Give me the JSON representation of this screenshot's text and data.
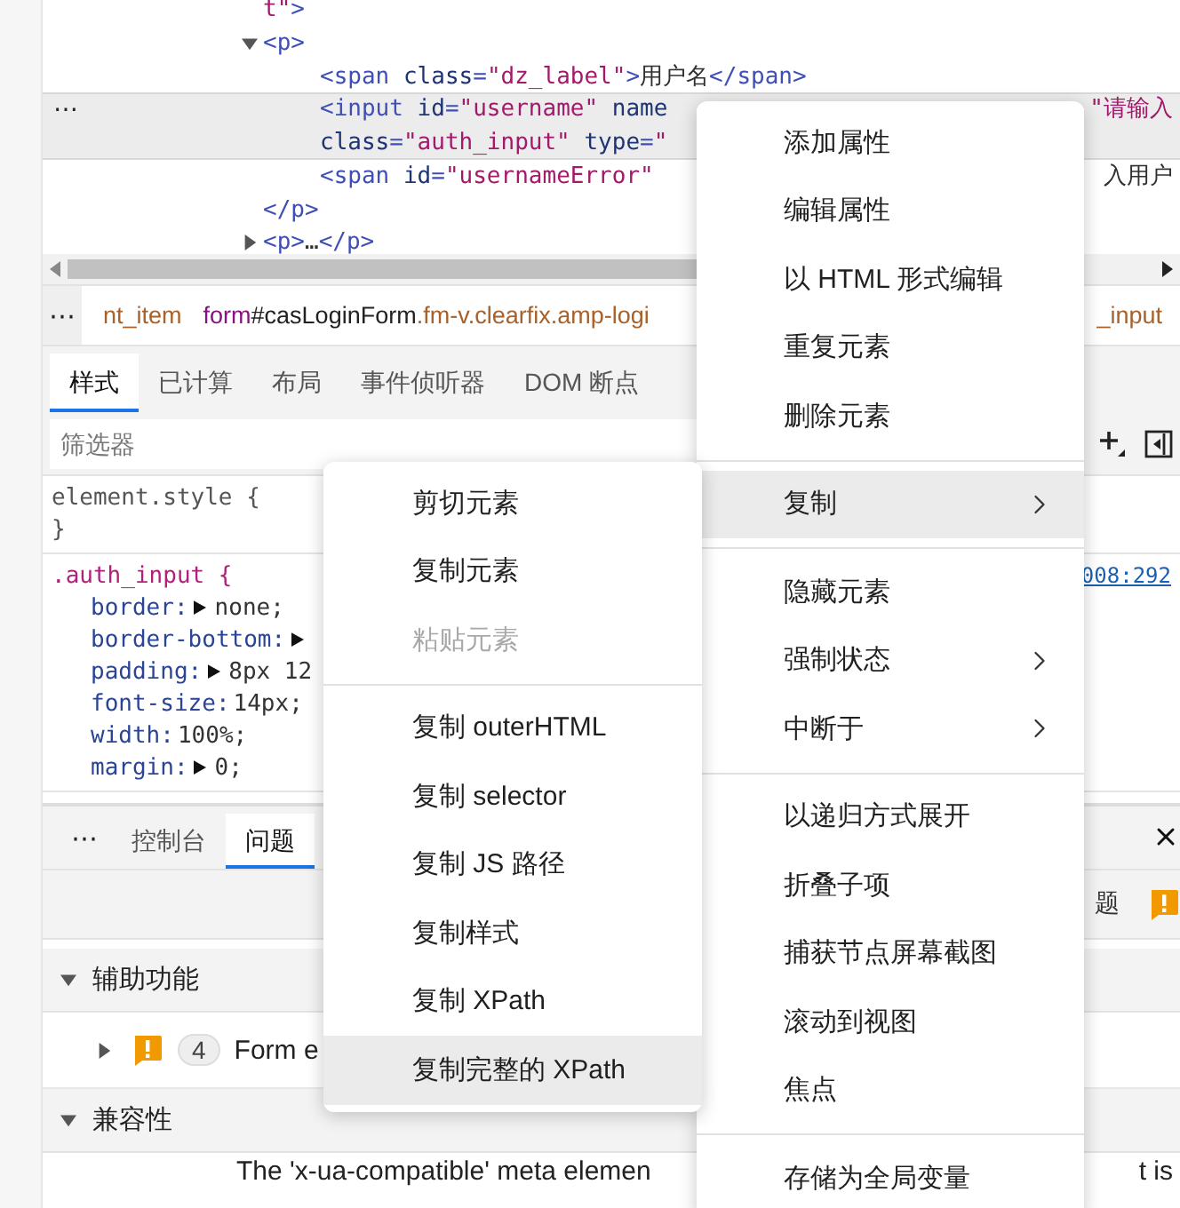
{
  "dom_tree": [
    {
      "tokens": [
        {
          "kind": "val",
          "t": "t\""
        },
        {
          "kind": "tag",
          "t": ">"
        }
      ],
      "selected": false
    },
    {
      "tokens": [
        {
          "kind": "tag",
          "t": "<p>"
        }
      ],
      "expanded": true,
      "selected": false,
      "children": [
        {
          "tokens": [
            {
              "kind": "tag",
              "t": "<span"
            },
            {
              "kind": "attr",
              "t": " class"
            },
            {
              "kind": "tag",
              "t": "="
            },
            {
              "kind": "val",
              "t": "\"dz_label\""
            },
            {
              "kind": "tag",
              "t": ">"
            },
            {
              "kind": "text",
              "t": "用户名"
            },
            {
              "kind": "tag",
              "t": "</span>"
            }
          ],
          "selected": false
        },
        {
          "tokens": [
            {
              "kind": "tag",
              "t": "<input"
            },
            {
              "kind": "attr",
              "t": " id"
            },
            {
              "kind": "tag",
              "t": "="
            },
            {
              "kind": "val",
              "t": "\"username\""
            },
            {
              "kind": "attr",
              "t": " name"
            }
          ],
          "more": [
            {
              "kind": "attr",
              "t": "class"
            },
            {
              "kind": "tag",
              "t": "="
            },
            {
              "kind": "val",
              "t": "\"auth_input\""
            },
            {
              "kind": "attr",
              "t": " type"
            },
            {
              "kind": "tag",
              "t": "="
            },
            {
              "kind": "val",
              "t": "\""
            }
          ],
          "right": [
            {
              "kind": "val",
              "t": "\"请输入"
            }
          ],
          "selected": true
        },
        {
          "tokens": [
            {
              "kind": "tag",
              "t": "<span"
            },
            {
              "kind": "attr",
              "t": " id"
            },
            {
              "kind": "tag",
              "t": "="
            },
            {
              "kind": "val",
              "t": "\"usernameError\""
            }
          ],
          "right": [
            {
              "kind": "text",
              "t": "入用户"
            }
          ],
          "selected": false
        }
      ],
      "closing": [
        {
          "kind": "tag",
          "t": "</p>"
        }
      ]
    },
    {
      "tokens": [
        {
          "kind": "tag",
          "t": "<p>"
        },
        {
          "kind": "text",
          "t": "…"
        },
        {
          "kind": "tag",
          "t": "</p>"
        }
      ],
      "expanded": false,
      "selected": false
    }
  ],
  "row_menu": "⋯",
  "breadcrumb": {
    "more": "⋯",
    "items": [
      {
        "tokens": [
          {
            "kind": "cls",
            "t": "nt_item"
          }
        ]
      },
      {
        "tokens": [
          {
            "kind": "tagname",
            "t": "form"
          },
          {
            "kind": "id",
            "t": "#casLoginForm"
          },
          {
            "kind": "cls",
            "t": ".fm-v.clearfix.amp-logi"
          }
        ]
      }
    ],
    "right": [
      {
        "kind": "cls",
        "t": "_input"
      }
    ]
  },
  "style_tabs": [
    {
      "label": "样式",
      "selected": true
    },
    {
      "label": "已计算",
      "selected": false
    },
    {
      "label": "布局",
      "selected": false
    },
    {
      "label": "事件侦听器",
      "selected": false
    },
    {
      "label": "DOM 断点",
      "selected": false
    }
  ],
  "filter": {
    "placeholder": "筛选器"
  },
  "rules": [
    {
      "kind": "inline",
      "selector": "element.style {",
      "close": "}"
    },
    {
      "kind": "class",
      "selector": ".auth_input {",
      "source": "008:292",
      "declarations": [
        {
          "name": "border:",
          "value": "none;",
          "expandable": true
        },
        {
          "name": "border-bottom:",
          "expandable": true
        },
        {
          "name": "padding:",
          "value": "8px 12",
          "expandable": true
        },
        {
          "name": "font-size:",
          "value": "14px;",
          "expandable": false
        },
        {
          "name": "width:",
          "value": "100%;",
          "expandable": false
        },
        {
          "name": "margin:",
          "value": "0;",
          "expandable": true
        }
      ]
    }
  ],
  "drawer": {
    "more": "⋯",
    "tabs": [
      {
        "label": "控制台",
        "selected": false
      },
      {
        "label": "问题",
        "selected": true
      }
    ]
  },
  "issues_toolbar": {
    "label": "题"
  },
  "sections": [
    {
      "title": "辅助功能",
      "expanded": true,
      "issues": [
        {
          "count": "4",
          "text": "Form e",
          "expanded": false
        }
      ]
    },
    {
      "title": "兼容性",
      "expanded": true,
      "text": "The 'x-ua-compatible' meta elemen",
      "text_right": "t is"
    }
  ],
  "context_menu": {
    "groups": [
      [
        {
          "label": "添加属性",
          "submenu": false,
          "selected": false
        },
        {
          "label": "编辑属性",
          "submenu": false,
          "selected": false
        },
        {
          "label": "以 HTML 形式编辑",
          "submenu": false,
          "selected": false
        },
        {
          "label": "重复元素",
          "submenu": false,
          "selected": false
        },
        {
          "label": "删除元素",
          "submenu": false,
          "selected": false
        }
      ],
      [
        {
          "label": "复制",
          "submenu": true,
          "selected": true
        }
      ],
      [
        {
          "label": "隐藏元素",
          "submenu": false,
          "selected": false
        },
        {
          "label": "强制状态",
          "submenu": true,
          "selected": false
        },
        {
          "label": "中断于",
          "submenu": true,
          "selected": false
        }
      ],
      [
        {
          "label": "以递归方式展开",
          "submenu": false,
          "selected": false
        },
        {
          "label": "折叠子项",
          "submenu": false,
          "selected": false
        },
        {
          "label": "捕获节点屏幕截图",
          "submenu": false,
          "selected": false
        },
        {
          "label": "滚动到视图",
          "submenu": false,
          "selected": false
        },
        {
          "label": "焦点",
          "submenu": false,
          "selected": false
        }
      ],
      [
        {
          "label": "存储为全局变量",
          "submenu": false,
          "selected": false
        }
      ]
    ]
  },
  "copy_submenu": {
    "groups": [
      [
        {
          "label": "剪切元素",
          "selected": false,
          "disabled": false
        },
        {
          "label": "复制元素",
          "selected": false,
          "disabled": false
        },
        {
          "label": "粘贴元素",
          "selected": false,
          "disabled": true
        }
      ],
      [
        {
          "label": "复制 outerHTML",
          "selected": false,
          "disabled": false
        },
        {
          "label": "复制 selector",
          "selected": false,
          "disabled": false
        },
        {
          "label": "复制 JS 路径",
          "selected": false,
          "disabled": false
        },
        {
          "label": "复制样式",
          "selected": false,
          "disabled": false
        },
        {
          "label": "复制 XPath",
          "selected": false,
          "disabled": false
        },
        {
          "label": "复制完整的 XPath",
          "selected": true,
          "disabled": false
        }
      ]
    ]
  }
}
